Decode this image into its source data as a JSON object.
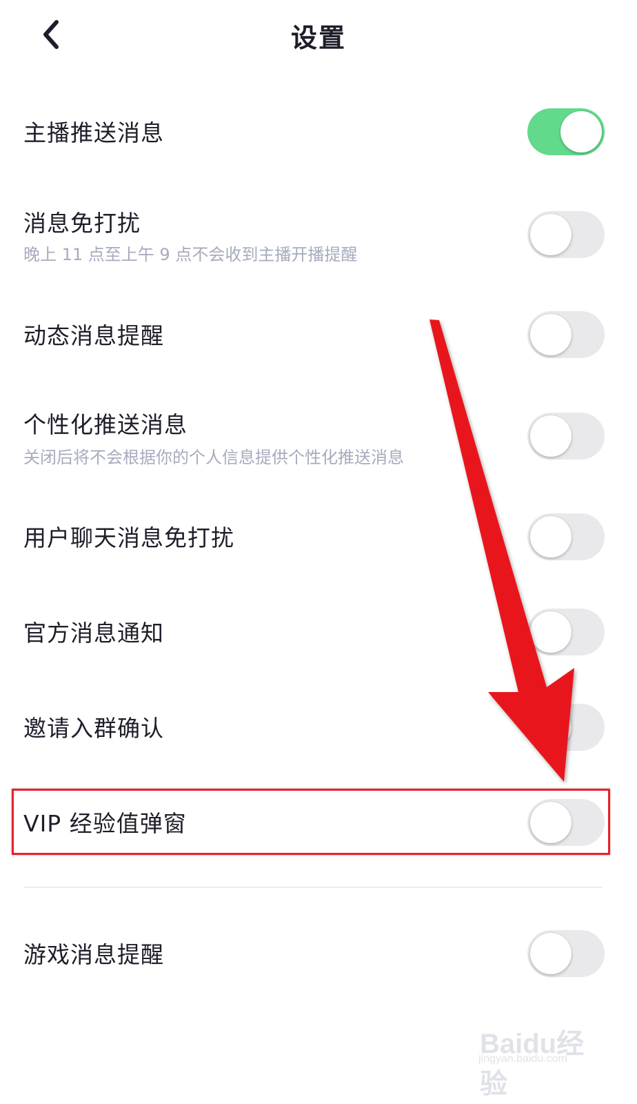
{
  "header": {
    "title": "设置",
    "back_icon": "chevron-left-icon"
  },
  "settings": [
    {
      "title": "主播推送消息",
      "subtitle": "",
      "on": true
    },
    {
      "title": "消息免打扰",
      "subtitle": "晚上 11 点至上午 9 点不会收到主播开播提醒",
      "on": false
    },
    {
      "title": "动态消息提醒",
      "subtitle": "",
      "on": false
    },
    {
      "title": "个性化推送消息",
      "subtitle": "关闭后将不会根据你的个人信息提供个性化推送消息",
      "on": false
    },
    {
      "title": "用户聊天消息免打扰",
      "subtitle": "",
      "on": false
    },
    {
      "title": "官方消息通知",
      "subtitle": "",
      "on": false
    },
    {
      "title": "邀请入群确认",
      "subtitle": "",
      "on": false
    },
    {
      "title": "VIP 经验值弹窗",
      "subtitle": "",
      "on": false
    },
    {
      "title": "游戏消息提醒",
      "subtitle": "",
      "on": false
    }
  ],
  "annotation": {
    "arrow_color": "#e8121c",
    "highlight_color": "#e8202a"
  },
  "watermark": {
    "brand": "Baidu经验",
    "url": "jingyan.baidu.com"
  },
  "colors": {
    "toggle_on": "#62d98b",
    "toggle_off": "#e9e9ec",
    "subtitle": "#a6abbd"
  }
}
